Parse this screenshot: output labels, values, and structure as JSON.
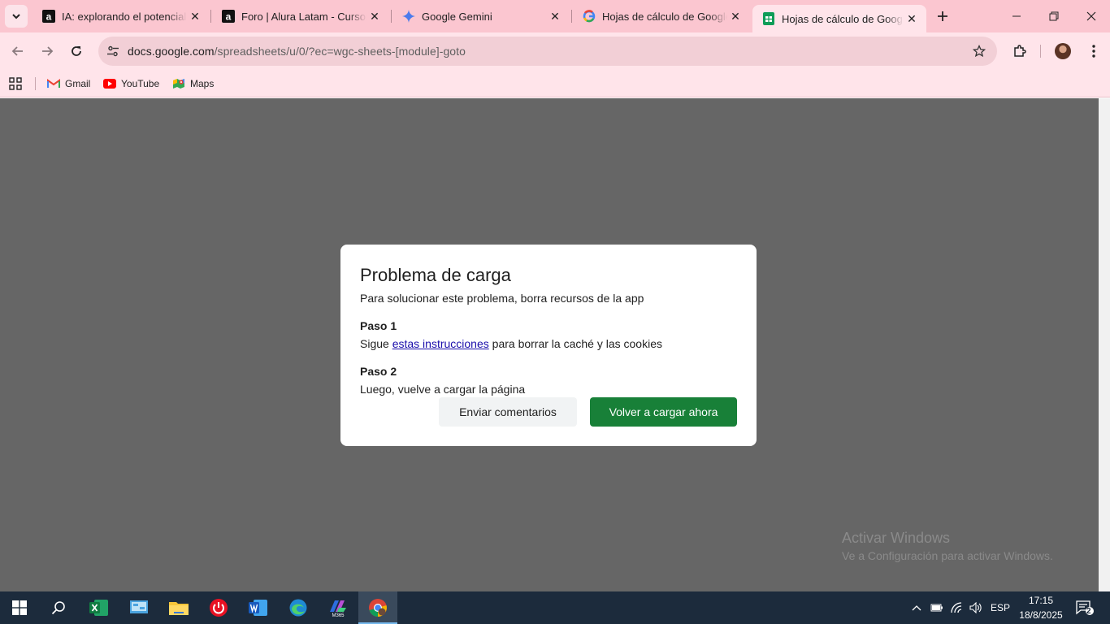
{
  "browser": {
    "tabs": [
      {
        "title": "IA: explorando el potencial de",
        "favicon": "alura-icon"
      },
      {
        "title": "Foro | Alura Latam - Cursos o",
        "favicon": "alura-icon"
      },
      {
        "title": "Google Gemini",
        "favicon": "gemini-icon"
      },
      {
        "title": "Hojas de cálculo de Google: ",
        "favicon": "google-icon"
      },
      {
        "title": "Hojas de cálculo de Google",
        "favicon": "sheets-icon"
      }
    ],
    "url_host": "docs.google.com",
    "url_path": "/spreadsheets/u/0/?ec=wgc-sheets-[module]-goto",
    "bookmarks": [
      "Gmail",
      "YouTube",
      "Maps"
    ],
    "accent": "#fbc6d0"
  },
  "dialog": {
    "title": "Problema de carga",
    "subtitle": "Para solucionar este problema, borra recursos de la app",
    "step1_label": "Paso 1",
    "step1_pre": "Sigue ",
    "step1_link": "estas instrucciones",
    "step1_post": " para borrar la caché y las cookies",
    "step2_label": "Paso 2",
    "step2_text": "Luego, vuelve a cargar la página",
    "secondary_button": "Enviar comentarios",
    "primary_button": "Volver a cargar ahora",
    "primary_color": "#188038"
  },
  "watermark": {
    "line1": "Activar Windows",
    "line2": "Ve a Configuración para activar Windows."
  },
  "taskbar": {
    "language": "ESP",
    "time": "17:15",
    "date": "18/8/2025",
    "notifications": "2",
    "apps": [
      "start-icon",
      "search-icon",
      "excel-icon",
      "control-panel-icon",
      "file-explorer-icon",
      "power-icon",
      "word-icon",
      "edge-icon",
      "m365-icon",
      "chrome-icon"
    ]
  }
}
